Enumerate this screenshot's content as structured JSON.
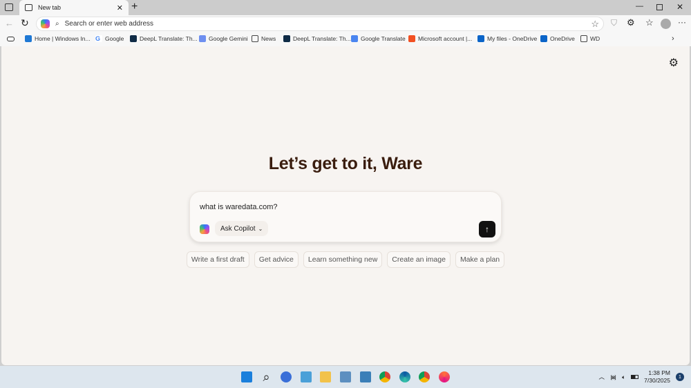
{
  "browser": {
    "tab_title": "New tab",
    "address_placeholder": "Search or enter web address"
  },
  "bookmarks": [
    {
      "label": "Home | Windows In...",
      "icon": "windows-icon"
    },
    {
      "label": "Google",
      "icon": "google-icon"
    },
    {
      "label": "DeepL Translate: Th...",
      "icon": "deepl-icon"
    },
    {
      "label": "Google Gemini",
      "icon": "gemini-icon"
    },
    {
      "label": "News",
      "icon": "folder-icon"
    },
    {
      "label": "DeepL Translate: Th...",
      "icon": "deepl-icon"
    },
    {
      "label": "Google Translate",
      "icon": "google-translate-icon"
    },
    {
      "label": "Microsoft account |...",
      "icon": "microsoft-icon"
    },
    {
      "label": "My files - OneDrive",
      "icon": "onedrive-icon"
    },
    {
      "label": "OneDrive",
      "icon": "onedrive-icon"
    },
    {
      "label": "WD",
      "icon": "folder-icon"
    }
  ],
  "main": {
    "greeting": "Let’s get to it, Ware",
    "query": "what is waredata.com?",
    "mode": "Ask Copilot",
    "chips": [
      "Write a first draft",
      "Get advice",
      "Learn something new",
      "Create an image",
      "Make a plan"
    ]
  },
  "taskbar": {
    "time": "1:38 PM",
    "date": "7/30/2025",
    "notifications": "1",
    "apps": [
      "start",
      "search",
      "copilot",
      "photos",
      "file-explorer",
      "notepad",
      "notes",
      "chrome",
      "edge",
      "chrome",
      "firefox"
    ]
  }
}
